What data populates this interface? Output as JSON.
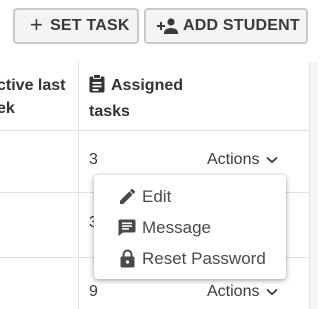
{
  "toolbar": {
    "set_task_label": "SET TASK",
    "add_student_label": "ADD STUDENT",
    "plus_glyph": "+"
  },
  "table": {
    "headers": {
      "active_last_week": "ctive last ek",
      "active_line1": "ctive last",
      "active_line2": "ek",
      "assigned_line1": "Assigned",
      "assigned_line2": "tasks"
    },
    "rows": [
      {
        "assigned_tasks": "3",
        "actions_label": "Actions"
      },
      {
        "assigned_tasks": "3",
        "actions_label": ""
      },
      {
        "assigned_tasks": "9",
        "actions_label": "Actions"
      }
    ]
  },
  "menu": {
    "items": [
      {
        "label": "Edit",
        "icon": "pencil-icon"
      },
      {
        "label": "Message",
        "icon": "message-icon"
      },
      {
        "label": "Reset Password",
        "icon": "lock-icon"
      }
    ]
  },
  "colors": {
    "text": "#3a3a3a",
    "button_bg": "#f4f4f4",
    "button_border": "#c9c9c9",
    "divider": "#e2e2e2"
  }
}
